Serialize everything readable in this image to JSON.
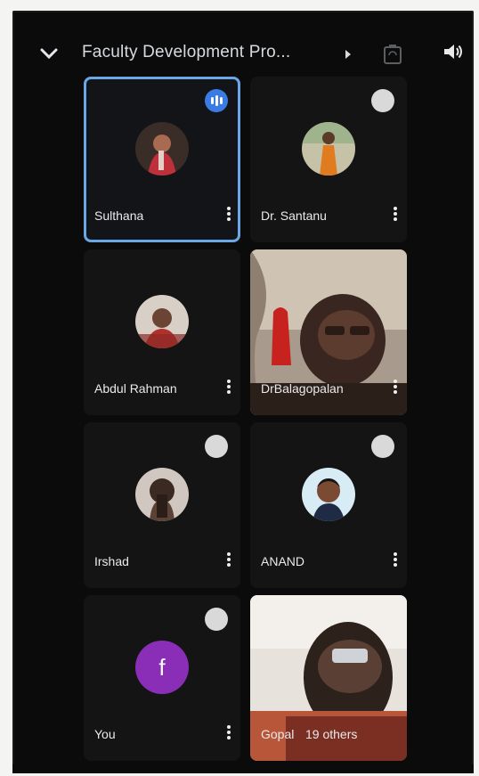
{
  "header": {
    "meeting_title": "Faculty Development Pro...",
    "icons": [
      "chevron-down-icon",
      "switch-camera-icon",
      "speaker-icon"
    ]
  },
  "participants": [
    {
      "name": "Sulthana",
      "status": "speaking",
      "avatar": "photo"
    },
    {
      "name": "Dr. Santanu",
      "status": "muted",
      "avatar": "photo"
    },
    {
      "name": "Abdul Rahman",
      "status": "none",
      "avatar": "photo"
    },
    {
      "name": "DrBalagopalan",
      "status": "none",
      "avatar": "video"
    },
    {
      "name": "Irshad",
      "status": "muted",
      "avatar": "photo"
    },
    {
      "name": "ANAND",
      "status": "muted",
      "avatar": "photo"
    },
    {
      "name": "You",
      "status": "muted",
      "avatar": "letter",
      "avatar_letter": "f"
    },
    {
      "name": "Gopal",
      "status": "none",
      "avatar": "video",
      "others_label": "19 others"
    }
  ],
  "colors": {
    "background": "#0b0b0b",
    "active_border": "#6aa7e6",
    "speaking_badge": "#3b7be4",
    "letter_avatar": "#8a2eb8"
  }
}
